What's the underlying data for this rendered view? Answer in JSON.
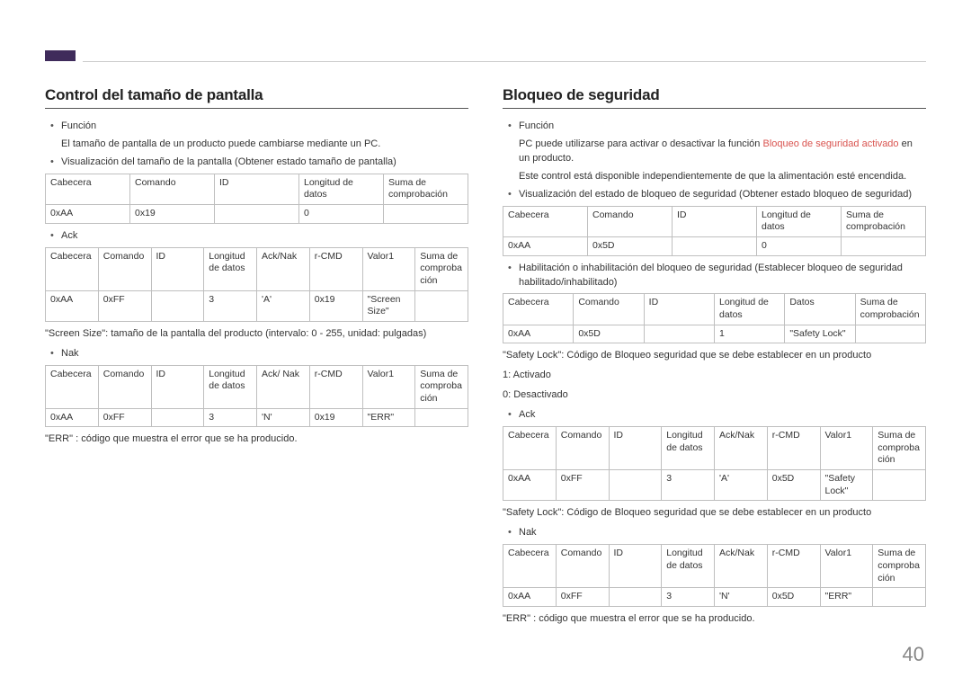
{
  "page_number": "40",
  "left": {
    "heading": "Control del tamaño de pantalla",
    "b1_label": "Función",
    "b1_text": "El tamaño de pantalla de un producto puede cambiarse mediante un PC.",
    "b2": "Visualización del tamaño de la pantalla (Obtener estado tamaño de pantalla)",
    "table1": {
      "headers": [
        "Cabecera",
        "Comando",
        "ID",
        "Longitud de datos",
        "Suma de comprobación"
      ],
      "row": [
        "0xAA",
        "0x19",
        "",
        "0",
        ""
      ]
    },
    "b3": "Ack",
    "table2": {
      "headers": [
        "Cabecera",
        "Comando",
        "ID",
        "Longitud de datos",
        "Ack/Nak",
        "r-CMD",
        "Valor1",
        "Suma de comprobación"
      ],
      "row": [
        "0xAA",
        "0xFF",
        "",
        "3",
        "'A'",
        "0x19",
        "\"Screen Size\"",
        ""
      ]
    },
    "caption1": "\"Screen Size\": tamaño de la pantalla del producto (intervalo: 0 - 255, unidad: pulgadas)",
    "b4": "Nak",
    "table3": {
      "headers": [
        "Cabecera",
        "Comando",
        "ID",
        "Longitud de datos",
        "Ack/ Nak",
        "r-CMD",
        "Valor1",
        "Suma de comprobación"
      ],
      "row": [
        "0xAA",
        "0xFF",
        "",
        "3",
        "'N'",
        "0x19",
        "\"ERR\"",
        ""
      ]
    },
    "caption2": "\"ERR\" : código que muestra el error que se ha producido."
  },
  "right": {
    "heading": "Bloqueo de seguridad",
    "b1_label": "Función",
    "b1_pre": "PC puede utilizarse para activar o desactivar la función ",
    "b1_red": "Bloqueo de seguridad activado",
    "b1_post": " en un producto.",
    "b1_line2": "Este control está disponible independientemente de que la alimentación esté encendida.",
    "b2": "Visualización del estado de bloqueo de seguridad (Obtener estado bloqueo de seguridad)",
    "table1": {
      "headers": [
        "Cabecera",
        "Comando",
        "ID",
        "Longitud de datos",
        "Suma de comprobación"
      ],
      "row": [
        "0xAA",
        "0x5D",
        "",
        "0",
        ""
      ]
    },
    "b3": "Habilitación o inhabilitación del bloqueo de seguridad (Establecer bloqueo de seguridad habilitado/inhabilitado)",
    "table2": {
      "headers": [
        "Cabecera",
        "Comando",
        "ID",
        "Longitud de datos",
        "Datos",
        "Suma de comprobación"
      ],
      "row": [
        "0xAA",
        "0x5D",
        "",
        "1",
        "\"Safety Lock\"",
        ""
      ]
    },
    "caption1": "\"Safety Lock\": Código de Bloqueo seguridad que se debe establecer en un producto",
    "code1": "1: Activado",
    "code0": "0: Desactivado",
    "b4": "Ack",
    "table3": {
      "headers": [
        "Cabecera",
        "Comando",
        "ID",
        "Longitud de datos",
        "Ack/Nak",
        "r-CMD",
        "Valor1",
        "Suma de comprobación"
      ],
      "row": [
        "0xAA",
        "0xFF",
        "",
        "3",
        "'A'",
        "0x5D",
        "\"Safety Lock\"",
        ""
      ]
    },
    "caption2": "\"Safety Lock\": Código de Bloqueo seguridad que se debe establecer en un producto",
    "b5": "Nak",
    "table4": {
      "headers": [
        "Cabecera",
        "Comando",
        "ID",
        "Longitud de datos",
        "Ack/Nak",
        "r-CMD",
        "Valor1",
        "Suma de comprobación"
      ],
      "row": [
        "0xAA",
        "0xFF",
        "",
        "3",
        "'N'",
        "0x5D",
        "\"ERR\"",
        ""
      ]
    },
    "caption3": "\"ERR\" : código que muestra el error que se ha producido."
  }
}
